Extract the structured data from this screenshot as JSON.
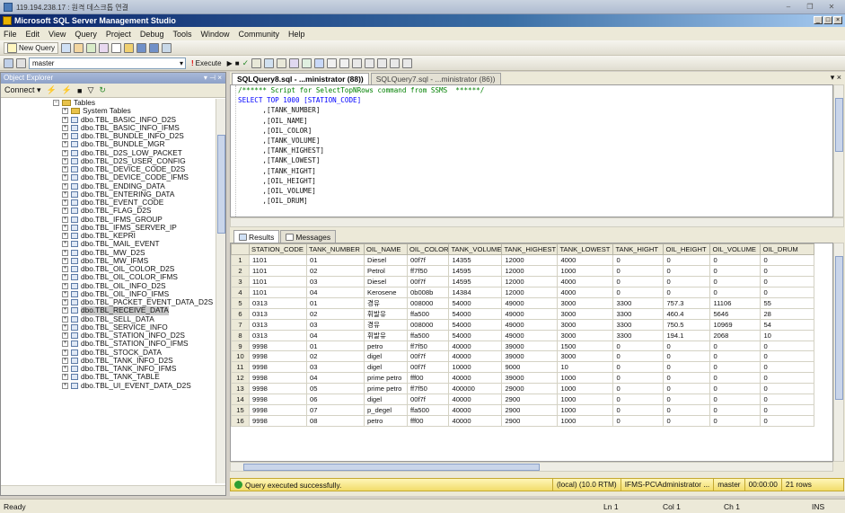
{
  "remote_title": "119.194.238.17 : 원격 데스크톱 연결",
  "window_title": "Microsoft SQL Server Management Studio",
  "menu": [
    "File",
    "Edit",
    "View",
    "Query",
    "Project",
    "Debug",
    "Tools",
    "Window",
    "Community",
    "Help"
  ],
  "toolbar": {
    "new_query": "New Query",
    "database": "master",
    "execute": "Execute"
  },
  "object_explorer": {
    "title": "Object Explorer",
    "connect": "Connect",
    "tables_label": "Tables",
    "items": [
      {
        "label": "System Tables",
        "type": "folder"
      },
      {
        "label": "dbo.TBL_BASIC_INFO_D2S"
      },
      {
        "label": "dbo.TBL_BASIC_INFO_IFMS"
      },
      {
        "label": "dbo.TBL_BUNDLE_INFO_D2S"
      },
      {
        "label": "dbo.TBL_BUNDLE_MGR"
      },
      {
        "label": "dbo.TBL_D2S_LOW_PACKET"
      },
      {
        "label": "dbo.TBL_D2S_USER_CONFIG"
      },
      {
        "label": "dbo.TBL_DEVICE_CODE_D2S"
      },
      {
        "label": "dbo.TBL_DEVICE_CODE_IFMS"
      },
      {
        "label": "dbo.TBL_ENDING_DATA"
      },
      {
        "label": "dbo.TBL_ENTERING_DATA"
      },
      {
        "label": "dbo.TBL_EVENT_CODE"
      },
      {
        "label": "dbo.TBL_FLAG_D2S"
      },
      {
        "label": "dbo.TBL_IFMS_GROUP"
      },
      {
        "label": "dbo.TBL_IFMS_SERVER_IP"
      },
      {
        "label": "dbo.TBL_KEPRI"
      },
      {
        "label": "dbo.TBL_MAIL_EVENT"
      },
      {
        "label": "dbo.TBL_MW_D2S"
      },
      {
        "label": "dbo.TBL_MW_IFMS"
      },
      {
        "label": "dbo.TBL_OIL_COLOR_D2S"
      },
      {
        "label": "dbo.TBL_OIL_COLOR_IFMS"
      },
      {
        "label": "dbo.TBL_OIL_INFO_D2S"
      },
      {
        "label": "dbo.TBL_OIL_INFO_IFMS"
      },
      {
        "label": "dbo.TBL_PACKET_EVENT_DATA_D2S"
      },
      {
        "label": "dbo.TBL_RECEIVE_DATA",
        "selected": true
      },
      {
        "label": "dbo.TBL_SELL_DATA"
      },
      {
        "label": "dbo.TBL_SERVICE_INFO"
      },
      {
        "label": "dbo.TBL_STATION_INFO_D2S"
      },
      {
        "label": "dbo.TBL_STATION_INFO_IFMS"
      },
      {
        "label": "dbo.TBL_STOCK_DATA"
      },
      {
        "label": "dbo.TBL_TANK_INFO_D2S"
      },
      {
        "label": "dbo.TBL_TANK_INFO_IFMS"
      },
      {
        "label": "dbo.TBL_TANK_TABLE"
      },
      {
        "label": "dbo.TBL_UI_EVENT_DATA_D2S"
      }
    ]
  },
  "editor": {
    "tabs": [
      "SQLQuery8.sql - ...ministrator (88))",
      "SQLQuery7.sql - ...ministrator (86))"
    ],
    "lines": [
      {
        "text": "/****** Script for SelectTopNRows command from SSMS  ******/",
        "cls": "cm"
      },
      {
        "text": "SELECT TOP 1000 [STATION_CODE]",
        "cls": "kw"
      },
      {
        "text": "      ,[TANK_NUMBER]",
        "cls": ""
      },
      {
        "text": "      ,[OIL_NAME]",
        "cls": ""
      },
      {
        "text": "      ,[OIL_COLOR]",
        "cls": ""
      },
      {
        "text": "      ,[TANK_VOLUME]",
        "cls": ""
      },
      {
        "text": "      ,[TANK_HIGHEST]",
        "cls": ""
      },
      {
        "text": "      ,[TANK_LOWEST]",
        "cls": ""
      },
      {
        "text": "      ,[TANK_HIGHT]",
        "cls": ""
      },
      {
        "text": "      ,[OIL_HEIGHT]",
        "cls": ""
      },
      {
        "text": "      ,[OIL_VOLUME]",
        "cls": ""
      },
      {
        "text": "      ,[OIL_DRUM]",
        "cls": ""
      }
    ]
  },
  "results": {
    "tabs": [
      "Results",
      "Messages"
    ],
    "columns": [
      "STATION_CODE",
      "TANK_NUMBER",
      "OIL_NAME",
      "OIL_COLOR",
      "TANK_VOLUME",
      "TANK_HIGHEST",
      "TANK_LOWEST",
      "TANK_HIGHT",
      "OIL_HEIGHT",
      "OIL_VOLUME",
      "OIL_DRUM"
    ],
    "rows": [
      [
        "1101",
        "01",
        "Diesel",
        "00f7f",
        "14355",
        "12000",
        "4000",
        "0",
        "0",
        "0",
        "0"
      ],
      [
        "1101",
        "02",
        "Petrol",
        "ff7f50",
        "14595",
        "12000",
        "1000",
        "0",
        "0",
        "0",
        "0"
      ],
      [
        "1101",
        "03",
        "Diesel",
        "00f7f",
        "14595",
        "12000",
        "4000",
        "0",
        "0",
        "0",
        "0"
      ],
      [
        "1101",
        "04",
        "Kerosene",
        "0b008b",
        "14384",
        "12000",
        "4000",
        "0",
        "0",
        "0",
        "0"
      ],
      [
        "0313",
        "01",
        "경유",
        "008000",
        "54000",
        "49000",
        "3000",
        "3300",
        "757.3",
        "11106",
        "55"
      ],
      [
        "0313",
        "02",
        "휘발유",
        "ffa500",
        "54000",
        "49000",
        "3000",
        "3300",
        "460.4",
        "5646",
        "28"
      ],
      [
        "0313",
        "03",
        "경유",
        "008000",
        "54000",
        "49000",
        "3000",
        "3300",
        "750.5",
        "10969",
        "54"
      ],
      [
        "0313",
        "04",
        "휘발유",
        "ffa500",
        "54000",
        "49000",
        "3000",
        "3300",
        "194.1",
        "2068",
        "10"
      ],
      [
        "9998",
        "01",
        "petro",
        "ff7f50",
        "40000",
        "39000",
        "1500",
        "0",
        "0",
        "0",
        "0"
      ],
      [
        "9998",
        "02",
        "digel",
        "00f7f",
        "40000",
        "39000",
        "3000",
        "0",
        "0",
        "0",
        "0"
      ],
      [
        "9998",
        "03",
        "digel",
        "00f7f",
        "10000",
        "9000",
        "10",
        "0",
        "0",
        "0",
        "0"
      ],
      [
        "9998",
        "04",
        "prime petro",
        "fff00",
        "40000",
        "39000",
        "1000",
        "0",
        "0",
        "0",
        "0"
      ],
      [
        "9998",
        "05",
        "prime petro",
        "ff7f50",
        "400000",
        "29000",
        "1000",
        "0",
        "0",
        "0",
        "0"
      ],
      [
        "9998",
        "06",
        "digel",
        "00f7f",
        "40000",
        "2900",
        "1000",
        "0",
        "0",
        "0",
        "0"
      ],
      [
        "9998",
        "07",
        "p_degel",
        "ffa500",
        "40000",
        "2900",
        "1000",
        "0",
        "0",
        "0",
        "0"
      ],
      [
        "9998",
        "08",
        "petro",
        "fff00",
        "40000",
        "2900",
        "1000",
        "0",
        "0",
        "0",
        "0"
      ]
    ]
  },
  "query_status": {
    "message": "Query executed successfully.",
    "server": "(local) (10.0 RTM)",
    "user": "IFMS-PC\\Administrator ...",
    "database": "master",
    "time": "00:00:00",
    "rows": "21 rows"
  },
  "statusbar": {
    "ready": "Ready",
    "ln": "Ln 1",
    "col": "Col 1",
    "ch": "Ch 1",
    "mode": "INS"
  }
}
